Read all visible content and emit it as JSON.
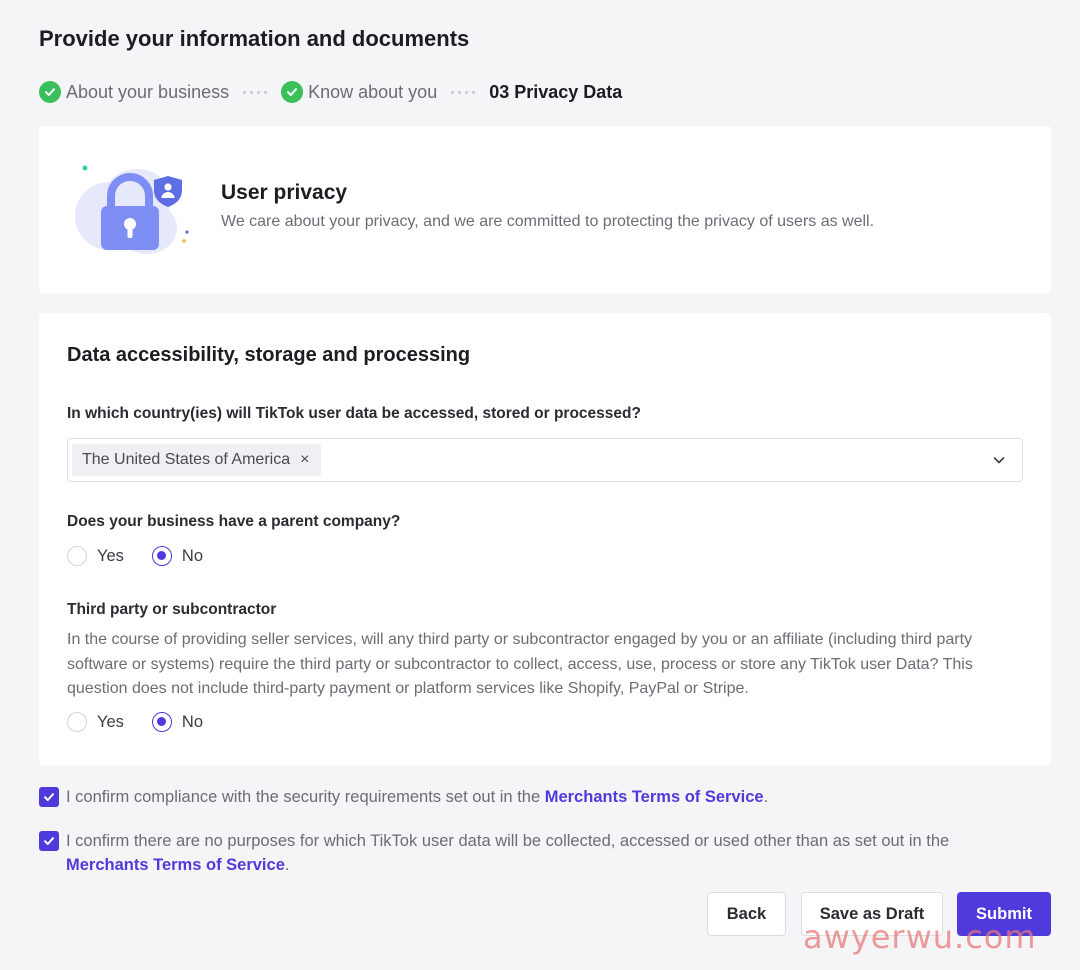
{
  "page": {
    "title": "Provide your information and documents"
  },
  "steps": [
    {
      "label": "About your business",
      "state": "done"
    },
    {
      "label": "Know about you",
      "state": "done"
    },
    {
      "label": "03 Privacy Data",
      "state": "current"
    }
  ],
  "privacy_card": {
    "title": "User privacy",
    "description": "We care about your privacy, and we are committed to protecting the privacy of users as well."
  },
  "data_section": {
    "title": "Data accessibility, storage and processing",
    "country_question": "In which country(ies) will TikTok user data be accessed, stored or processed?",
    "selected_country": "The United States of America",
    "remove_glyph": "×",
    "parent_question": "Does your business have a parent company?",
    "parent_options": {
      "yes": "Yes",
      "no": "No",
      "selected": "No"
    },
    "third_party_title": "Third party or subcontractor",
    "third_party_description": "In the course of providing seller services, will any third party or subcontractor engaged by you or an affiliate (including third party software or systems) require the third party or subcontractor to collect, access, use, process or store any TikTok user Data? This question does not include third-party payment or platform services like Shopify, PayPal or Stripe.",
    "third_party_options": {
      "yes": "Yes",
      "no": "No",
      "selected": "No"
    }
  },
  "confirmations": [
    {
      "text": "I confirm compliance with the security requirements set out in the ",
      "link": "Merchants Terms of Service",
      "suffix": ".",
      "checked": true
    },
    {
      "text": "I confirm there are no purposes for which TikTok user data will be collected, accessed or used other than as set out in the ",
      "link": "Merchants Terms of Service",
      "suffix": ".",
      "checked": true
    }
  ],
  "actions": {
    "back": "Back",
    "save_draft": "Save as Draft",
    "submit": "Submit"
  },
  "watermark": "awyerwu.com",
  "colors": {
    "accent": "#4f3bdb",
    "success": "#3bbf5a",
    "background": "#f5f5f7"
  }
}
